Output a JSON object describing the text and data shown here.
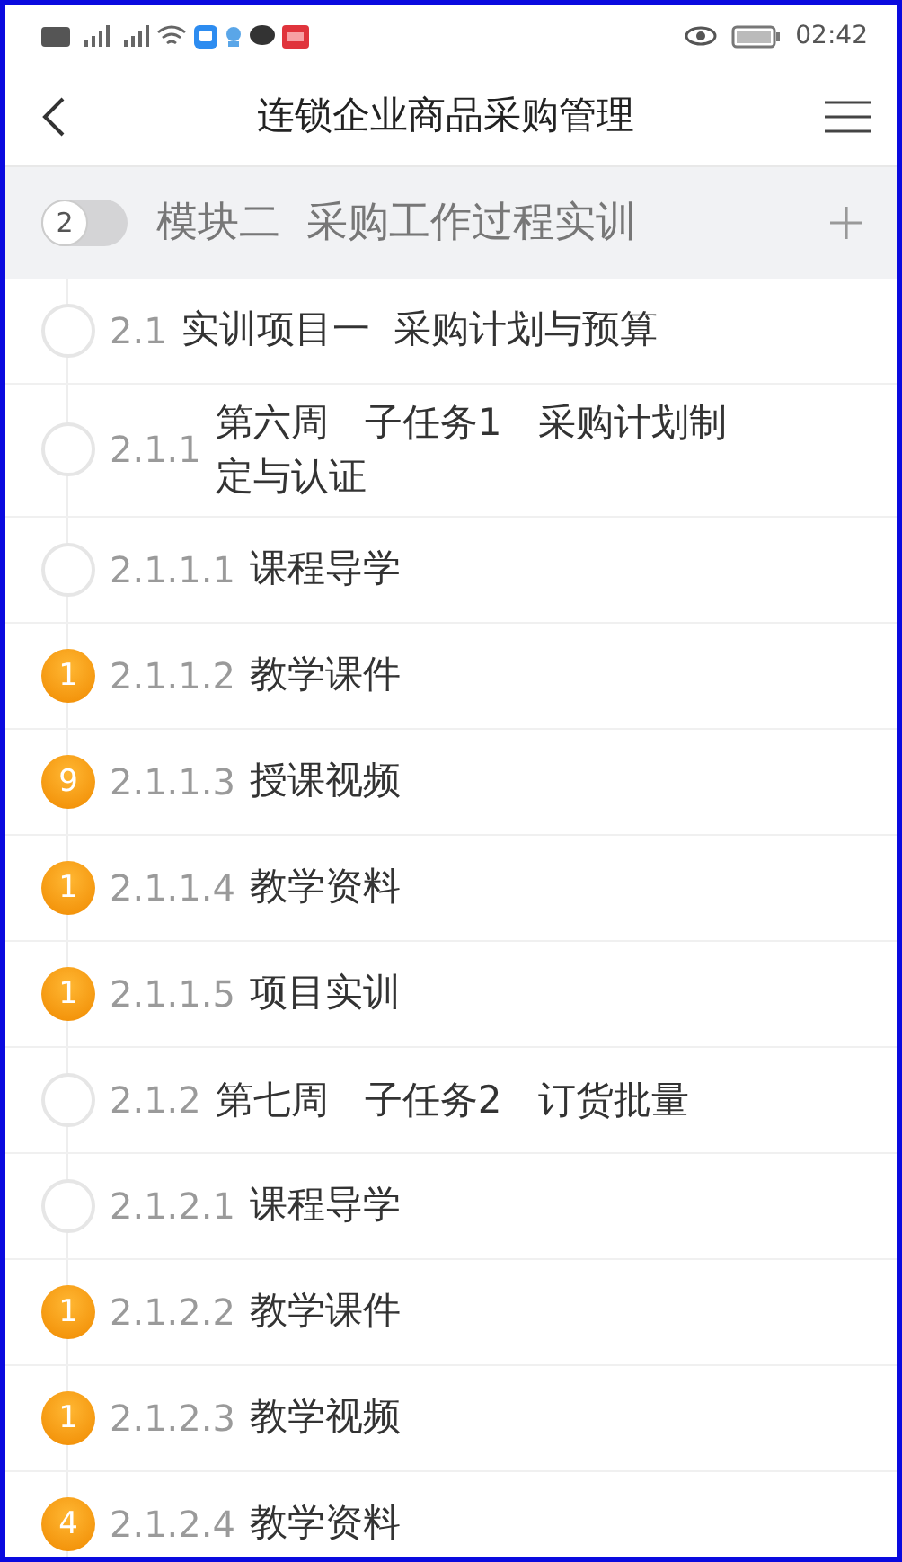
{
  "status_bar": {
    "time": "02:42"
  },
  "header": {
    "title": "连锁企业商品采购管理"
  },
  "module": {
    "badge": "2",
    "title": "模块二  采购工作过程实训",
    "expanded": true
  },
  "items": [
    {
      "number": "2.1",
      "title": "实训项目一  采购计划与预算"
    },
    {
      "number": "2.1.1",
      "title": "第六周   子任务1   采购计划制定与认证"
    },
    {
      "number": "2.1.1.1",
      "title": "课程导学"
    },
    {
      "number": "2.1.1.2",
      "title": "教学课件",
      "badge": "1"
    },
    {
      "number": "2.1.1.3",
      "title": "授课视频",
      "badge": "9"
    },
    {
      "number": "2.1.1.4",
      "title": "教学资料",
      "badge": "1"
    },
    {
      "number": "2.1.1.5",
      "title": "项目实训",
      "badge": "1"
    },
    {
      "number": "2.1.2",
      "title": "第七周   子任务2   订货批量"
    },
    {
      "number": "2.1.2.1",
      "title": "课程导学"
    },
    {
      "number": "2.1.2.2",
      "title": "教学课件",
      "badge": "1"
    },
    {
      "number": "2.1.2.3",
      "title": "教学视频",
      "badge": "1"
    },
    {
      "number": "2.1.2.4",
      "title": "教学资料",
      "badge": "4"
    }
  ]
}
